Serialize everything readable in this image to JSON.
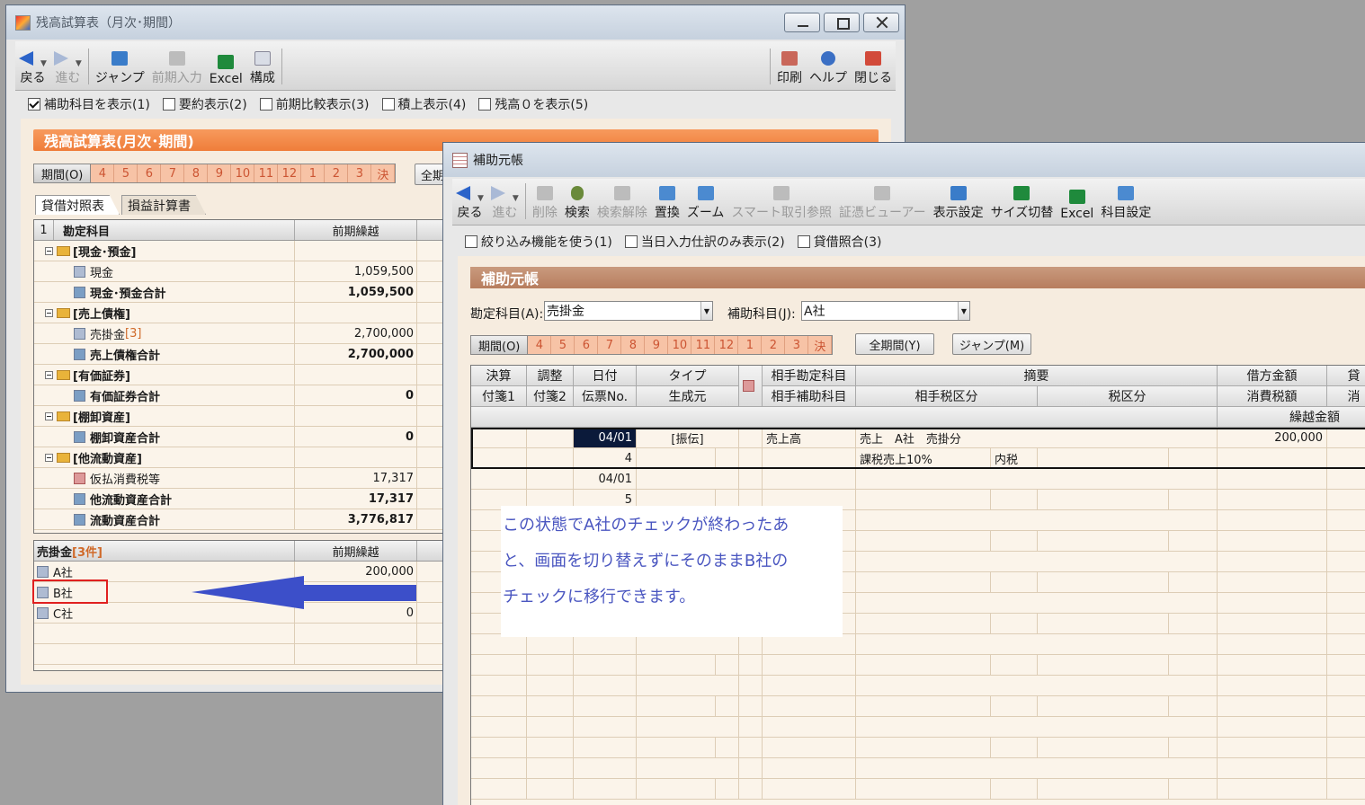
{
  "trial_window": {
    "title": "残高試算表（月次･期間）",
    "toolbar": [
      {
        "label": "戻る",
        "icon": "back-arrow-icon",
        "enabled": true,
        "caret": true
      },
      {
        "label": "進む",
        "icon": "forward-arrow-icon",
        "enabled": false,
        "caret": true
      },
      {
        "label": "ジャンプ",
        "icon": "jump-icon",
        "enabled": true
      },
      {
        "label": "前期入力",
        "icon": "previous-period-icon",
        "enabled": false
      },
      {
        "label": "Excel",
        "icon": "excel-icon",
        "enabled": true
      },
      {
        "label": "構成",
        "icon": "layout-icon",
        "enabled": true
      }
    ],
    "toolbar_right": [
      {
        "label": "印刷",
        "icon": "print-icon"
      },
      {
        "label": "ヘルプ",
        "icon": "help-icon"
      },
      {
        "label": "閉じる",
        "icon": "close-door-icon"
      }
    ],
    "options": [
      {
        "label": "補助科目を表示(1)",
        "checked": true
      },
      {
        "label": "要約表示(2)",
        "checked": false
      },
      {
        "label": "前期比較表示(3)",
        "checked": false
      },
      {
        "label": "積上表示(4)",
        "checked": false
      },
      {
        "label": "残高０を表示(5)",
        "checked": false
      }
    ],
    "section_title": "残高試算表(月次･期間)",
    "period_label": "期間(O)",
    "months": [
      "4",
      "5",
      "6",
      "7",
      "8",
      "9",
      "10",
      "11",
      "12",
      "1",
      "2",
      "3",
      "決"
    ],
    "all_period_button": "全期",
    "tabs": [
      "貸借対照表",
      "損益計算書"
    ],
    "header": {
      "index": "1",
      "account": "勘定科目",
      "carry": "前期繰越"
    },
    "rows": [
      {
        "type": "group",
        "label": "[現金･預金]",
        "value": ""
      },
      {
        "type": "item",
        "label": "現金",
        "value": "1,059,500"
      },
      {
        "type": "sum",
        "label": "現金･預金合計",
        "value": "1,059,500"
      },
      {
        "type": "group",
        "label": "[売上債権]",
        "value": ""
      },
      {
        "type": "item",
        "label": "売掛金",
        "badge": "[3]",
        "value": "2,700,000"
      },
      {
        "type": "sum",
        "label": "売上債権合計",
        "value": "2,700,000"
      },
      {
        "type": "group",
        "label": "[有価証券]",
        "value": ""
      },
      {
        "type": "sum",
        "label": "有価証券合計",
        "value": "0"
      },
      {
        "type": "group",
        "label": "[棚卸資産]",
        "value": ""
      },
      {
        "type": "sum",
        "label": "棚卸資産合計",
        "value": "0"
      },
      {
        "type": "group",
        "label": "[他流動資産]",
        "value": ""
      },
      {
        "type": "item",
        "label": "仮払消費税等",
        "value": "17,317"
      },
      {
        "type": "sum",
        "label": "他流動資産合計",
        "value": "17,317"
      },
      {
        "type": "sum",
        "label": "流動資産合計",
        "value": "3,776,817"
      }
    ],
    "sub_header": {
      "account": "売掛金",
      "count": "[3件]",
      "carry": "前期繰越"
    },
    "sub_rows": [
      {
        "label": "A社",
        "value": "200,000"
      },
      {
        "label": "B社",
        "value": ""
      },
      {
        "label": "C社",
        "value": "0"
      }
    ]
  },
  "ledger_window": {
    "title": "補助元帳",
    "toolbar": [
      {
        "label": "戻る",
        "icon": "back-arrow-icon",
        "enabled": true,
        "caret": true
      },
      {
        "label": "進む",
        "icon": "forward-arrow-icon",
        "enabled": false,
        "caret": true
      },
      {
        "label": "削除",
        "icon": "delete-icon",
        "enabled": false
      },
      {
        "label": "検索",
        "icon": "search-icon",
        "enabled": true
      },
      {
        "label": "検索解除",
        "icon": "search-clear-icon",
        "enabled": false
      },
      {
        "label": "置換",
        "icon": "replace-icon",
        "enabled": true
      },
      {
        "label": "ズーム",
        "icon": "zoom-icon",
        "enabled": true
      },
      {
        "label": "スマート取引参照",
        "icon": "smart-reference-icon",
        "enabled": false
      },
      {
        "label": "証憑ビューアー",
        "icon": "voucher-viewer-icon",
        "enabled": false
      },
      {
        "label": "表示設定",
        "icon": "display-settings-icon",
        "enabled": true
      },
      {
        "label": "サイズ切替",
        "icon": "size-toggle-icon",
        "enabled": true
      },
      {
        "label": "Excel",
        "icon": "excel-icon",
        "enabled": true
      },
      {
        "label": "科目設定",
        "icon": "account-settings-icon",
        "enabled": true
      }
    ],
    "options": [
      {
        "label": "絞り込み機能を使う(1)",
        "checked": false
      },
      {
        "label": "当日入力仕訳のみ表示(2)",
        "checked": false
      },
      {
        "label": "貸借照合(3)",
        "checked": false
      }
    ],
    "section_title": "補助元帳",
    "account_label": "勘定科目(A):",
    "account_value": "売掛金",
    "sub_account_label": "補助科目(J):",
    "sub_account_value": "A社",
    "period_label": "期間(O)",
    "months": [
      "4",
      "5",
      "6",
      "7",
      "8",
      "9",
      "10",
      "11",
      "12",
      "1",
      "2",
      "3",
      "決"
    ],
    "all_period_button": "全期間(Y)",
    "jump_button": "ジャンプ(M)",
    "headers": {
      "h1": [
        "決算",
        "調整",
        "日付",
        "タイプ",
        "",
        "相手勘定科目",
        "摘要",
        "借方金額",
        "貸"
      ],
      "h2": [
        "付箋1",
        "付箋2",
        "伝票No.",
        "生成元",
        "",
        "相手補助科目",
        "相手税区分",
        "税区分",
        "消費税額",
        "消"
      ],
      "h3": "繰越金額"
    },
    "entries": [
      {
        "date": "04/01",
        "type": "[振伝]",
        "partner": "売上高",
        "summary": "売上　A社　売掛分",
        "debit": "200,000",
        "no": "4",
        "tax_class": "課税売上10%",
        "tax_mode": "内税"
      },
      {
        "date": "04/01",
        "no": "5"
      }
    ]
  },
  "annotation": {
    "text": "この状態でA社のチェックが終わったあ\nと、画面を切り替えずにそのままB社の\nチェックに移行できます。",
    "arrow_color": "#3c4fc9",
    "highlight_color": "#e02020"
  }
}
